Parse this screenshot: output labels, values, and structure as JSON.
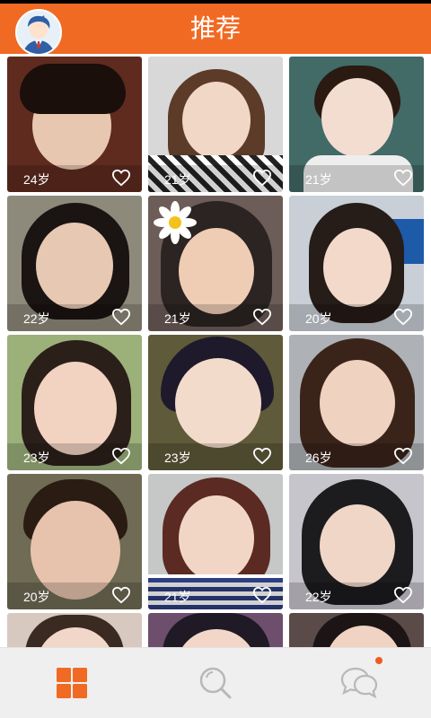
{
  "header": {
    "title": "推荐"
  },
  "cards": [
    {
      "age": "24岁",
      "bg": "#5f2b1f",
      "face": "#e8c7b1",
      "hair": "#1a0f0a"
    },
    {
      "age": "21岁",
      "bg": "#d8d8d8",
      "face": "#f1d7c6",
      "hair": "#5c3b28"
    },
    {
      "age": "21岁",
      "bg": "#426a67",
      "face": "#f3ddd0",
      "hair": "#2a1a12"
    },
    {
      "age": "22岁",
      "bg": "#8e8a7b",
      "face": "#e7c8b2",
      "hair": "#1a1412"
    },
    {
      "age": "21岁",
      "bg": "#6d5d58",
      "face": "#efcdb5",
      "hair": "#2b2423"
    },
    {
      "age": "20岁",
      "bg": "#c8cfd6",
      "face": "#f2d9ca",
      "hair": "#261c18"
    },
    {
      "age": "23岁",
      "bg": "#9cb07a",
      "face": "#f2d3c2",
      "hair": "#2b1f1a"
    },
    {
      "age": "23岁",
      "bg": "#5f5a3a",
      "face": "#f3dbcb",
      "hair": "#1e1a2b"
    },
    {
      "age": "26岁",
      "bg": "#aeb2b6",
      "face": "#f0d2c1",
      "hair": "#3a241a"
    },
    {
      "age": "20岁",
      "bg": "#6f6b55",
      "face": "#e7c3ad",
      "hair": "#2a1c13"
    },
    {
      "age": "21岁",
      "bg": "#c6c7c7",
      "face": "#f1d6c6",
      "hair": "#5b2a22"
    },
    {
      "age": "22岁",
      "bg": "#c7c5cc",
      "face": "#f0d6c7",
      "hair": "#1c1c1f"
    },
    {
      "age": "",
      "bg": "#d8c9c0",
      "face": "#f1d7c9",
      "hair": "#3a2a22"
    },
    {
      "age": "",
      "bg": "#6e4e6d",
      "face": "#f2d6c7",
      "hair": "#1f1a25"
    },
    {
      "age": "",
      "bg": "#5a4b49",
      "face": "#f0d3c3",
      "hair": "#1d1515"
    }
  ],
  "tabbar": {
    "tabs": [
      {
        "icon": "grid-icon",
        "active": true
      },
      {
        "icon": "search-icon",
        "active": false
      },
      {
        "icon": "chat-icon",
        "active": false,
        "badge": true
      }
    ]
  },
  "colors": {
    "accent": "#f06a23",
    "tab_inactive": "#b8b8b8"
  }
}
